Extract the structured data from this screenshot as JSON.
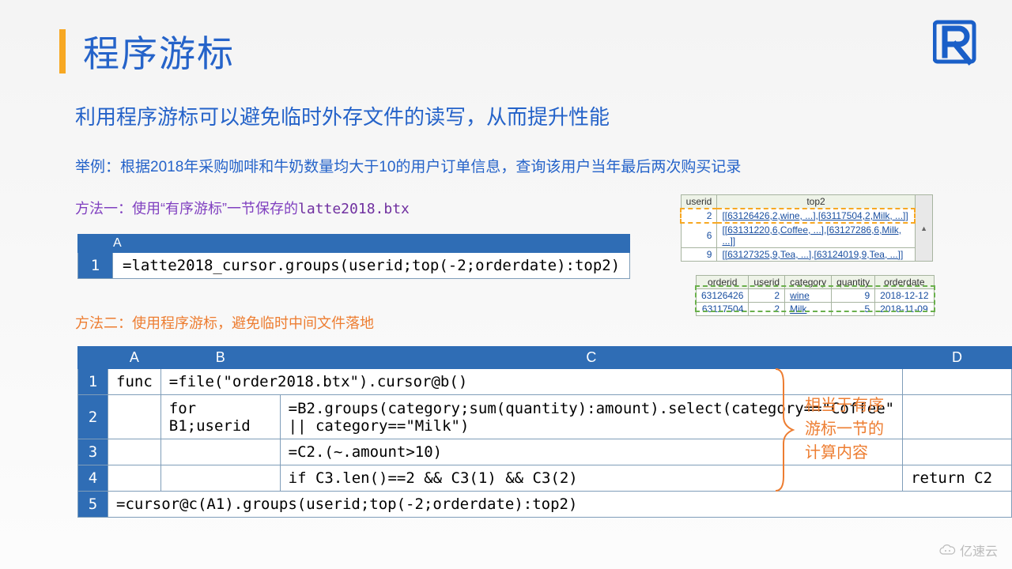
{
  "title": "程序游标",
  "subtitle": "利用程序游标可以避免临时外存文件的读写，从而提升性能",
  "example": "举例：根据2018年采购咖啡和牛奶数量均大于10的用户订单信息，查询该用户当年最后两次购买记录",
  "method1": {
    "prefix": "方法一：使用“有序游标”一节保存的",
    "filename": "latte2018.btx"
  },
  "method2": "方法二：使用程序游标，避免临时中间文件落地",
  "table1": {
    "header": "A",
    "rows": [
      {
        "n": "1",
        "a": "=latte2018_cursor.groups(userid;top(-2;orderdate):top2)"
      }
    ]
  },
  "table2": {
    "headers": [
      "A",
      "B",
      "C",
      "D"
    ],
    "rows": [
      {
        "n": "1",
        "a": "func",
        "b": "=file(\"order2018.btx\").cursor@b()",
        "c": "",
        "d": ""
      },
      {
        "n": "2",
        "a": "",
        "b": "for B1;userid",
        "c": "=B2.groups(category;sum(quantity):amount).select(category==\"Coffee\" || category==\"Milk\")",
        "d": ""
      },
      {
        "n": "3",
        "a": "",
        "b": "",
        "c": "=C2.(~.amount>10)",
        "d": ""
      },
      {
        "n": "4",
        "a": "",
        "b": "",
        "c": "if C3.len()==2 && C3(1) && C3(2)",
        "d": "return C2"
      },
      {
        "n": "5",
        "a": "=cursor@c(A1).groups(userid;top(-2;orderdate):top2)",
        "b": "",
        "c": "",
        "d": ""
      }
    ]
  },
  "result1": {
    "headers": [
      "userid",
      "top2"
    ],
    "rows": [
      {
        "userid": "2",
        "top2": "[[63126426,2,wine, ...],[63117504,2,Milk, ...]]"
      },
      {
        "userid": "6",
        "top2": "[[63131220,6,Coffee, ...],[63127286,6,Milk, ...]]"
      },
      {
        "userid": "9",
        "top2": "[[63127325,9,Tea, ...],[63124019,9,Tea, ...]]"
      }
    ]
  },
  "result2": {
    "headers": [
      "orderid",
      "userid",
      "category",
      "quantity",
      "orderdate"
    ],
    "rows": [
      {
        "orderid": "63126426",
        "userid": "2",
        "category": "wine",
        "quantity": "9",
        "orderdate": "2018-12-12"
      },
      {
        "orderid": "63117504",
        "userid": "2",
        "category": "Milk",
        "quantity": "5",
        "orderdate": "2018-11-09"
      }
    ]
  },
  "brace_note": {
    "l1": "相当于有序",
    "l2": "游标一节的",
    "l3": "计算内容"
  },
  "watermark": "亿速云"
}
